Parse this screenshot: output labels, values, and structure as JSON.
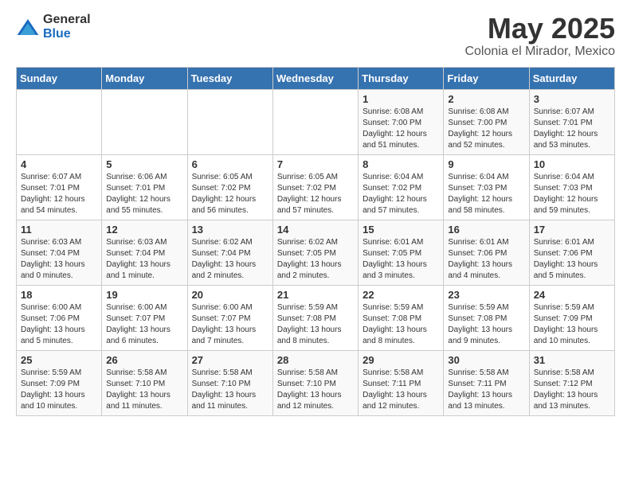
{
  "logo": {
    "general": "General",
    "blue": "Blue"
  },
  "title": "May 2025",
  "subtitle": "Colonia el Mirador, Mexico",
  "weekdays": [
    "Sunday",
    "Monday",
    "Tuesday",
    "Wednesday",
    "Thursday",
    "Friday",
    "Saturday"
  ],
  "weeks": [
    [
      {
        "day": "",
        "info": ""
      },
      {
        "day": "",
        "info": ""
      },
      {
        "day": "",
        "info": ""
      },
      {
        "day": "",
        "info": ""
      },
      {
        "day": "1",
        "info": "Sunrise: 6:08 AM\nSunset: 7:00 PM\nDaylight: 12 hours and 51 minutes."
      },
      {
        "day": "2",
        "info": "Sunrise: 6:08 AM\nSunset: 7:00 PM\nDaylight: 12 hours and 52 minutes."
      },
      {
        "day": "3",
        "info": "Sunrise: 6:07 AM\nSunset: 7:01 PM\nDaylight: 12 hours and 53 minutes."
      }
    ],
    [
      {
        "day": "4",
        "info": "Sunrise: 6:07 AM\nSunset: 7:01 PM\nDaylight: 12 hours and 54 minutes."
      },
      {
        "day": "5",
        "info": "Sunrise: 6:06 AM\nSunset: 7:01 PM\nDaylight: 12 hours and 55 minutes."
      },
      {
        "day": "6",
        "info": "Sunrise: 6:05 AM\nSunset: 7:02 PM\nDaylight: 12 hours and 56 minutes."
      },
      {
        "day": "7",
        "info": "Sunrise: 6:05 AM\nSunset: 7:02 PM\nDaylight: 12 hours and 57 minutes."
      },
      {
        "day": "8",
        "info": "Sunrise: 6:04 AM\nSunset: 7:02 PM\nDaylight: 12 hours and 57 minutes."
      },
      {
        "day": "9",
        "info": "Sunrise: 6:04 AM\nSunset: 7:03 PM\nDaylight: 12 hours and 58 minutes."
      },
      {
        "day": "10",
        "info": "Sunrise: 6:04 AM\nSunset: 7:03 PM\nDaylight: 12 hours and 59 minutes."
      }
    ],
    [
      {
        "day": "11",
        "info": "Sunrise: 6:03 AM\nSunset: 7:04 PM\nDaylight: 13 hours and 0 minutes."
      },
      {
        "day": "12",
        "info": "Sunrise: 6:03 AM\nSunset: 7:04 PM\nDaylight: 13 hours and 1 minute."
      },
      {
        "day": "13",
        "info": "Sunrise: 6:02 AM\nSunset: 7:04 PM\nDaylight: 13 hours and 2 minutes."
      },
      {
        "day": "14",
        "info": "Sunrise: 6:02 AM\nSunset: 7:05 PM\nDaylight: 13 hours and 2 minutes."
      },
      {
        "day": "15",
        "info": "Sunrise: 6:01 AM\nSunset: 7:05 PM\nDaylight: 13 hours and 3 minutes."
      },
      {
        "day": "16",
        "info": "Sunrise: 6:01 AM\nSunset: 7:06 PM\nDaylight: 13 hours and 4 minutes."
      },
      {
        "day": "17",
        "info": "Sunrise: 6:01 AM\nSunset: 7:06 PM\nDaylight: 13 hours and 5 minutes."
      }
    ],
    [
      {
        "day": "18",
        "info": "Sunrise: 6:00 AM\nSunset: 7:06 PM\nDaylight: 13 hours and 5 minutes."
      },
      {
        "day": "19",
        "info": "Sunrise: 6:00 AM\nSunset: 7:07 PM\nDaylight: 13 hours and 6 minutes."
      },
      {
        "day": "20",
        "info": "Sunrise: 6:00 AM\nSunset: 7:07 PM\nDaylight: 13 hours and 7 minutes."
      },
      {
        "day": "21",
        "info": "Sunrise: 5:59 AM\nSunset: 7:08 PM\nDaylight: 13 hours and 8 minutes."
      },
      {
        "day": "22",
        "info": "Sunrise: 5:59 AM\nSunset: 7:08 PM\nDaylight: 13 hours and 8 minutes."
      },
      {
        "day": "23",
        "info": "Sunrise: 5:59 AM\nSunset: 7:08 PM\nDaylight: 13 hours and 9 minutes."
      },
      {
        "day": "24",
        "info": "Sunrise: 5:59 AM\nSunset: 7:09 PM\nDaylight: 13 hours and 10 minutes."
      }
    ],
    [
      {
        "day": "25",
        "info": "Sunrise: 5:59 AM\nSunset: 7:09 PM\nDaylight: 13 hours and 10 minutes."
      },
      {
        "day": "26",
        "info": "Sunrise: 5:58 AM\nSunset: 7:10 PM\nDaylight: 13 hours and 11 minutes."
      },
      {
        "day": "27",
        "info": "Sunrise: 5:58 AM\nSunset: 7:10 PM\nDaylight: 13 hours and 11 minutes."
      },
      {
        "day": "28",
        "info": "Sunrise: 5:58 AM\nSunset: 7:10 PM\nDaylight: 13 hours and 12 minutes."
      },
      {
        "day": "29",
        "info": "Sunrise: 5:58 AM\nSunset: 7:11 PM\nDaylight: 13 hours and 12 minutes."
      },
      {
        "day": "30",
        "info": "Sunrise: 5:58 AM\nSunset: 7:11 PM\nDaylight: 13 hours and 13 minutes."
      },
      {
        "day": "31",
        "info": "Sunrise: 5:58 AM\nSunset: 7:12 PM\nDaylight: 13 hours and 13 minutes."
      }
    ]
  ]
}
